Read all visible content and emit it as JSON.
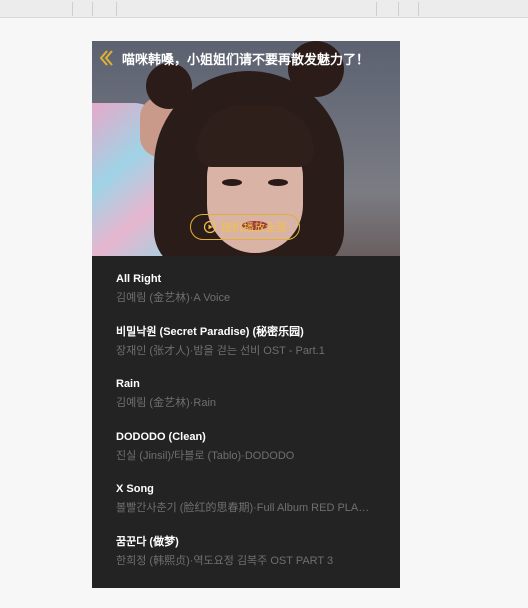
{
  "header": {
    "title": "喵咪韩嗓，小姐姐们请不要再散发魅力了！"
  },
  "play_all": {
    "label": "随机播放全部"
  },
  "accent_color": "#e0b233",
  "songs": [
    {
      "title": "All Right",
      "subtitle": "김예림 (金艺林)·A Voice"
    },
    {
      "title": "비밀낙원 (Secret Paradise) (秘密乐园)",
      "subtitle": "장재인 (张才人)·밤을 걷는 선비 OST - Part.1"
    },
    {
      "title": "Rain",
      "subtitle": "김예림 (金艺林)·Rain"
    },
    {
      "title": "DODODO (Clean)",
      "subtitle": "진실 (Jinsil)/타블로 (Tablo)·DODODO"
    },
    {
      "title": "X Song",
      "subtitle": "볼빨간사춘기 (脸红的思春期)·Full Album RED PLANET"
    },
    {
      "title": "꿈꾼다 (做梦)",
      "subtitle": "한희정 (韩熙贞)·역도요정 김복주 OST PART 3"
    }
  ]
}
